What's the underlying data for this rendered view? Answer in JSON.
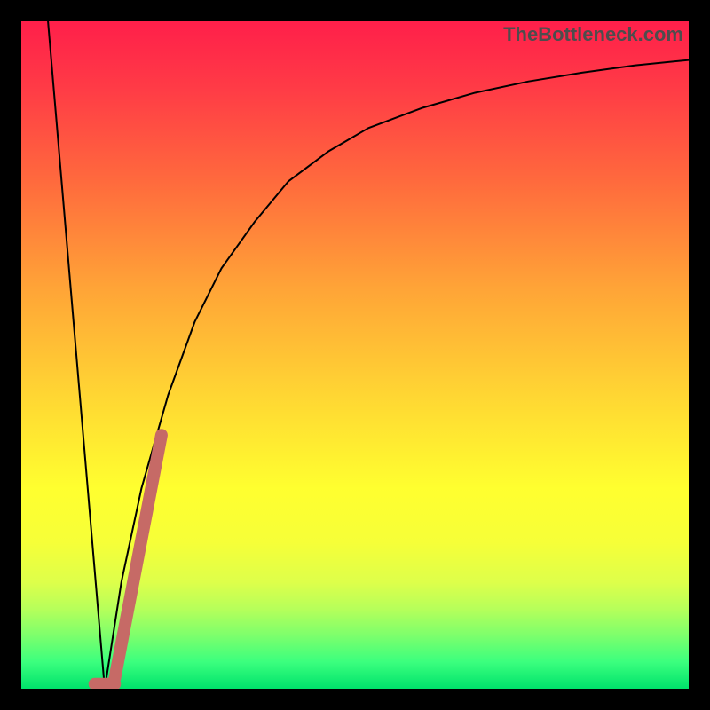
{
  "watermark": "TheBottleneck.com",
  "chart_data": {
    "type": "line",
    "title": "",
    "xlabel": "",
    "ylabel": "",
    "xlim": [
      0,
      100
    ],
    "ylim": [
      0,
      100
    ],
    "grid": false,
    "legend": false,
    "series": [
      {
        "name": "left-line",
        "color": "#000000",
        "width": 2,
        "x": [
          4,
          12.5
        ],
        "values": [
          100,
          0
        ]
      },
      {
        "name": "right-curve",
        "color": "#000000",
        "width": 2,
        "x": [
          12.5,
          15,
          18,
          22,
          26,
          30,
          35,
          40,
          46,
          52,
          60,
          68,
          76,
          84,
          92,
          100
        ],
        "values": [
          0,
          16,
          30,
          44,
          55,
          63,
          70,
          76,
          80.5,
          84,
          87,
          89.3,
          91,
          92.3,
          93.4,
          94.2
        ]
      },
      {
        "name": "pink-segment",
        "color": "#c66a66",
        "width": 14,
        "x": [
          14,
          21
        ],
        "values": [
          1.5,
          38
        ]
      },
      {
        "name": "pink-dot",
        "color": "#c66a66",
        "width": 14,
        "x": [
          11,
          14
        ],
        "values": [
          0.7,
          0.7
        ]
      }
    ]
  }
}
